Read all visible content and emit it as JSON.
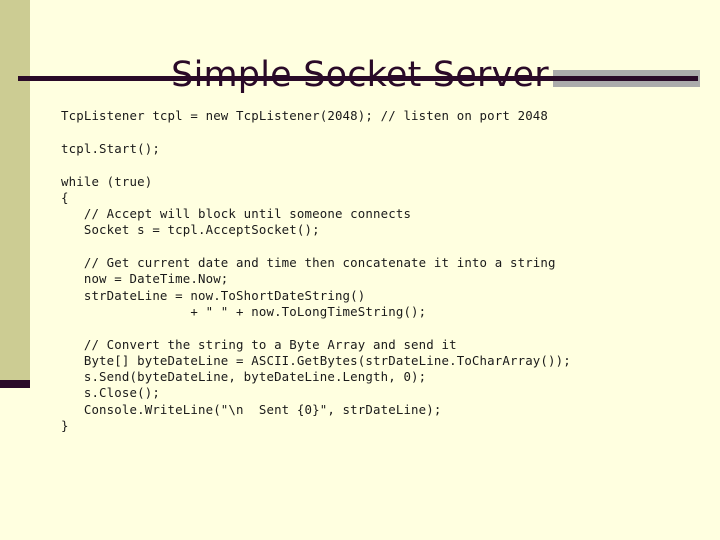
{
  "slide": {
    "title": "Simple Socket Server",
    "background_color": "#FFFFE0",
    "accent_color": "#2A0A28",
    "band_color": "#CCCC93",
    "shadow_color": "#ABABAB",
    "code_color": "#1A1A1A",
    "code": [
      "TcpListener tcpl = new TcpListener(2048); // listen on port 2048",
      "",
      "tcpl.Start();",
      "",
      "while (true)",
      "{",
      "   // Accept will block until someone connects",
      "   Socket s = tcpl.AcceptSocket();",
      "",
      "   // Get current date and time then concatenate it into a string",
      "   now = DateTime.Now;",
      "   strDateLine = now.ToShortDateString()",
      "                 + \" \" + now.ToLongTimeString();",
      "",
      "   // Convert the string to a Byte Array and send it",
      "   Byte[] byteDateLine = ASCII.GetBytes(strDateLine.ToCharArray());",
      "   s.Send(byteDateLine, byteDateLine.Length, 0);",
      "   s.Close();",
      "   Console.WriteLine(\"\\n  Sent {0}\", strDateLine);",
      "}"
    ]
  }
}
